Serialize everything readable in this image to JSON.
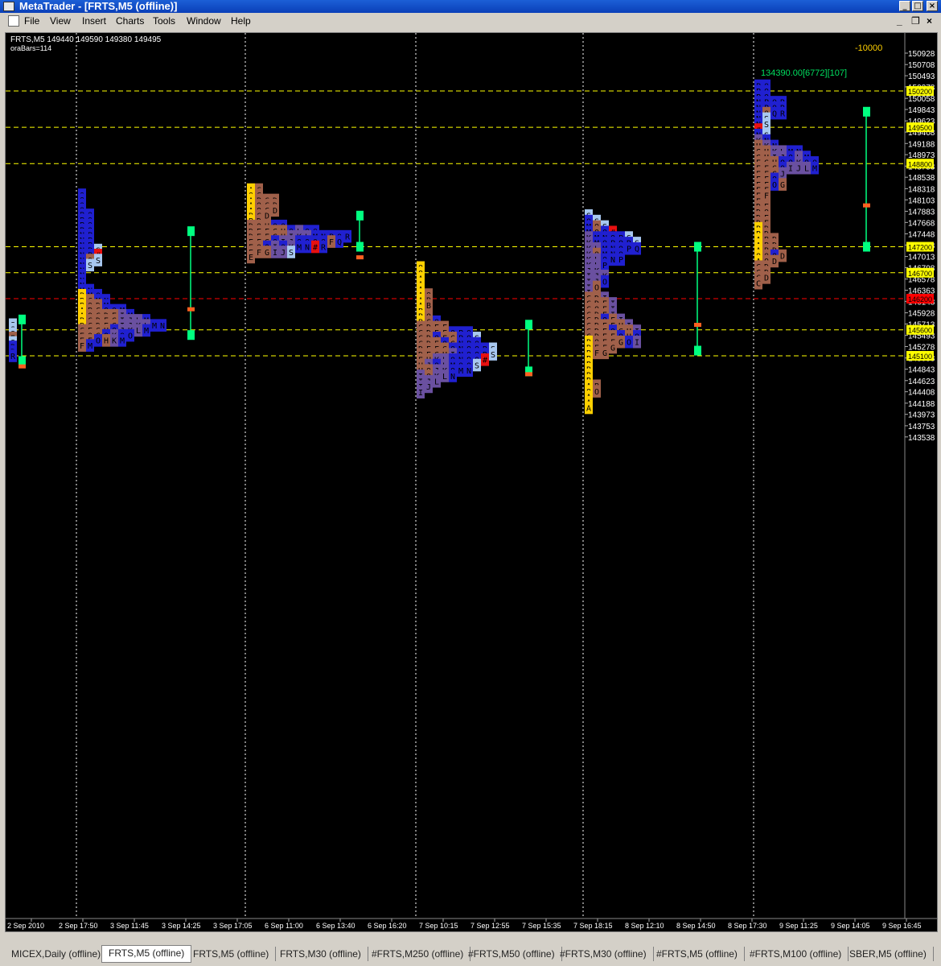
{
  "window": {
    "title": "MetaTrader - [FRTS,M5 (offline)]",
    "controls": [
      "_",
      "□",
      "×"
    ]
  },
  "menu": [
    "File",
    "View",
    "Insert",
    "Charts",
    "Tools",
    "Window",
    "Help"
  ],
  "chart": {
    "info_line1": "FRTS,M5  149440 149590 149380 149495",
    "info_line2": "oraBars=114",
    "top_value": "-10000",
    "stat_text": "134390.00[6772][107]",
    "colors": {
      "background": "#000000",
      "grid": "#ffffff",
      "level_line": "#ffff00",
      "current_line": "#ff0000",
      "bracket": "#00ff80",
      "tpo_blue": "#2020d0",
      "tpo_purple": "#6a50a0",
      "tpo_brown": "#a0604a",
      "tpo_yellow": "#ffd000"
    }
  },
  "chart_data": {
    "type": "market_profile",
    "symbol": "FRTS",
    "timeframe": "M5",
    "price_ticks": [
      "150928",
      "150708",
      "150493",
      "150278",
      "150058",
      "149843",
      "149623",
      "149408",
      "149188",
      "148973",
      "148753",
      "148538",
      "148318",
      "148103",
      "147883",
      "147668",
      "147448",
      "147233",
      "147013",
      "146798",
      "146578",
      "146363",
      "146148",
      "145928",
      "145713",
      "145493",
      "145278",
      "145058",
      "144843",
      "144623",
      "144408",
      "144188",
      "143973",
      "143753",
      "143538"
    ],
    "levels": [
      {
        "price": "150200",
        "color": "#ffff00"
      },
      {
        "price": "149500",
        "color": "#ffff00"
      },
      {
        "price": "148800",
        "color": "#ffff00"
      },
      {
        "price": "147200",
        "color": "#ffff00"
      },
      {
        "price": "146700",
        "color": "#ffff00"
      },
      {
        "price": "146200",
        "color": "#ff0000"
      },
      {
        "price": "145600",
        "color": "#ffff00"
      },
      {
        "price": "145100",
        "color": "#ffff00"
      }
    ],
    "time_ticks": [
      "2 Sep 2010",
      "2 Sep 17:50",
      "3 Sep 11:45",
      "3 Sep 14:25",
      "3 Sep 17:05",
      "6 Sep 11:00",
      "6 Sep 13:40",
      "6 Sep 16:20",
      "7 Sep 10:15",
      "7 Sep 12:55",
      "7 Sep 15:35",
      "7 Sep 18:15",
      "8 Sep 12:10",
      "8 Sep 14:50",
      "8 Sep 17:30",
      "9 Sep 11:25",
      "9 Sep 14:05",
      "9 Sep 16:45"
    ],
    "profiles": [
      {
        "session": "2 Sep",
        "high": "145700",
        "low": "145100",
        "rows": [
          "S",
          "S",
          "S",
          "E",
          "S",
          "R",
          "R",
          "R"
        ],
        "range_high": "145800",
        "range_low": "145000"
      },
      {
        "session": "3 Sep",
        "high": "148200",
        "low": "145300",
        "rows": [
          "Q",
          "Q",
          "Q",
          "Q",
          "PQ",
          "PQ",
          "PQ",
          "PQ",
          "NP",
          "NP",
          "NP",
          "NPS",
          "NP#",
          "NOS",
          "NS",
          "N",
          "N",
          "N",
          "N",
          "MN",
          "BMO",
          "BCMN",
          "BODM",
          "ABCOOM",
          "AOCDEIM",
          "BCDEGIJLM",
          "BCDEGIJKLMN",
          "CEGHOJKLM",
          "EOGOKOO",
          "EFOHKM",
          "FM"
        ],
        "range_high": "147500",
        "range_low": "145500"
      },
      {
        "session": "6 Sep",
        "high": "148300",
        "low": "147000",
        "rows": [
          "AC",
          "OC",
          "ABCD",
          "AOCD",
          "AOCD",
          "BCD",
          "BD",
          "DOHQQ",
          "DEFGHOLQQ",
          "DEFGHIKLMNPQR",
          "EFGOIJOOOOFQ",
          "EOOIOKMN#R",
          "EFGIJS",
          "E"
        ],
        "range_high": "147800",
        "range_low": "147200"
      },
      {
        "session": "7 Sep",
        "high": "146800",
        "low": "144400",
        "rows": [
          "O",
          "O",
          "A",
          "A",
          "A",
          "AO",
          "AB",
          "AB",
          "B",
          "BO",
          "BCO",
          "CDEF",
          "CDEFOPQ",
          "CDOFGPQS",
          "CDEOGNPQ",
          "DEFGONOQRS",
          "DEGHINOQRS",
          "EHKLONOQ#",
          "HJOLMOOS",
          "HOJKOMN",
          "IOKLN",
          "IJL",
          "IJ",
          "I"
        ],
        "range_high": "145700",
        "range_low": "144800"
      },
      {
        "session": "8 Sep",
        "high": "147800",
        "low": "144100",
        "rows": [
          "S",
          "QS",
          "MOS",
          "MOO#",
          "KMNOPS",
          "KMOPQRS",
          "KLMNOPQ",
          "KOMNO",
          "KLONP",
          "KLP",
          "JK",
          "IJK",
          "IJO",
          "IO",
          "I",
          "CDI",
          "CDEI",
          "COEI",
          "CDEI",
          "CDOFI",
          "CDEFHI",
          "CDEOGHI",
          "CDEFOHO",
          "BOEFGOI",
          "BEFG",
          "BFG",
          "B",
          "B",
          "B",
          "B",
          "B",
          "AB",
          "OO",
          "A",
          "A",
          "A"
        ],
        "range_high": "147200",
        "range_low": "145200"
      },
      {
        "session": "9 Sep",
        "high": "150300",
        "low": "146500",
        "rows": [
          "PQ",
          "PQ",
          "PQ",
          "NPQR",
          "NPQR",
          "NOQR",
          "NS",
          "NS",
          "#",
          "NS",
          "KN",
          "HKN",
          "GHKLMN",
          "GHIJOLM",
          "EGHOOKOO",
          "EFGOIJLM",
          "EFGJ",
          "EFO",
          "EFOG",
          "EF",
          "EF",
          "E",
          "DE",
          "DO",
          "DE",
          "DE",
          "BD",
          "BD",
          "ABD",
          "ABD",
          "ABD",
          "OOOD",
          "AOD",
          "CD",
          "CD",
          "CD",
          "C"
        ],
        "range_high": "149800",
        "range_low": "147200"
      }
    ]
  },
  "tabs": [
    "MICEX,Daily (offline)",
    "FRTS,M5 (offline)",
    "FRTS,M5 (offline)",
    "FRTS,M30 (offline)",
    "#FRTS,M250 (offline)",
    "#FRTS,M50 (offline)",
    "#FRTS,M30 (offline)",
    "#FRTS,M5 (offline)",
    "#FRTS,M100 (offline)",
    "SBER,M5 (offline)"
  ],
  "active_tab": "FRTS,M5 (offline)"
}
